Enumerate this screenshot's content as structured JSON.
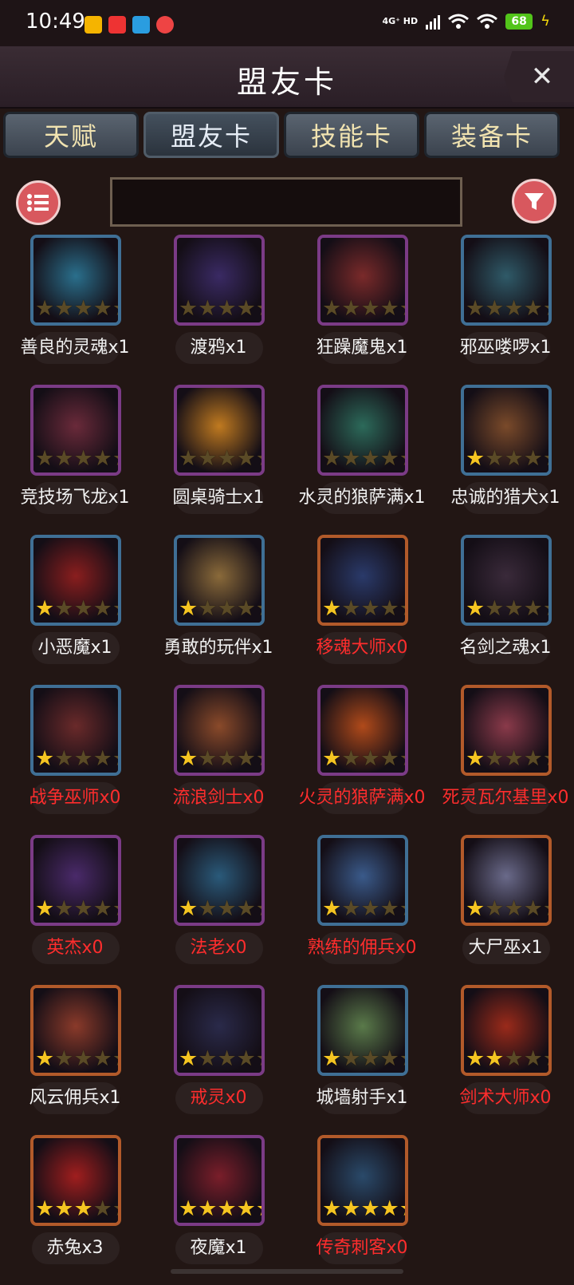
{
  "status": {
    "time": "10:49",
    "network": "4G⁺ HD",
    "battery": "68"
  },
  "header": {
    "title": "盟友卡",
    "close_icon": "close-icon"
  },
  "tabs": [
    {
      "label": "天赋",
      "active": false
    },
    {
      "label": "盟友卡",
      "active": true
    },
    {
      "label": "技能卡",
      "active": false
    },
    {
      "label": "装备卡",
      "active": false
    }
  ],
  "toolbar": {
    "list_icon": "list-icon",
    "filter_icon": "filter-icon",
    "search_value": ""
  },
  "colors": {
    "owned": "#f2f2f2",
    "missing": "#ff2d2d",
    "star_on": "#f5c521",
    "star_off": "#5a4a26"
  },
  "cards": [
    {
      "name": "善良的灵魂x1",
      "stars": 0,
      "owned": true,
      "border": "blue",
      "art": "#2a6f8c"
    },
    {
      "name": "渡鸦x1",
      "stars": 0,
      "owned": true,
      "border": "purple",
      "art": "#3a2a64"
    },
    {
      "name": "狂躁魔鬼x1",
      "stars": 0,
      "owned": true,
      "border": "purple",
      "art": "#7a2a2a"
    },
    {
      "name": "邪巫喽啰x1",
      "stars": 0,
      "owned": true,
      "border": "blue",
      "art": "#2f5a68"
    },
    {
      "name": "竞技场飞龙x1",
      "stars": 0,
      "owned": true,
      "border": "purple",
      "art": "#6a2a3a"
    },
    {
      "name": "圆桌骑士x1",
      "stars": 0,
      "owned": true,
      "border": "purple",
      "art": "#c07a20"
    },
    {
      "name": "水灵的狼萨满x1",
      "stars": 0,
      "owned": true,
      "border": "purple",
      "art": "#2c6a5a"
    },
    {
      "name": "忠诚的猎犬x1",
      "stars": 1,
      "owned": true,
      "border": "blue",
      "art": "#7a4a2a"
    },
    {
      "name": "小恶魔x1",
      "stars": 1,
      "owned": true,
      "border": "blue",
      "art": "#8a1e1e"
    },
    {
      "name": "勇敢的玩伴x1",
      "stars": 1,
      "owned": true,
      "border": "blue",
      "art": "#8a6a3a"
    },
    {
      "name": "移魂大师x0",
      "stars": 1,
      "owned": false,
      "border": "orange",
      "art": "#2a3a6a"
    },
    {
      "name": "名剑之魂x1",
      "stars": 1,
      "owned": true,
      "border": "blue",
      "art": "#3a2a3a"
    },
    {
      "name": "战争巫师x0",
      "stars": 1,
      "owned": false,
      "border": "blue",
      "art": "#6a2a2a"
    },
    {
      "name": "流浪剑士x0",
      "stars": 1,
      "owned": false,
      "border": "purple",
      "art": "#8a4a2a"
    },
    {
      "name": "火灵的狼萨满x0",
      "stars": 1,
      "owned": false,
      "border": "purple",
      "art": "#b04a1a"
    },
    {
      "name": "死灵瓦尔基里x0",
      "stars": 1,
      "owned": false,
      "border": "orange",
      "art": "#8a3a4a"
    },
    {
      "name": "英杰x0",
      "stars": 1,
      "owned": false,
      "border": "purple",
      "art": "#4a2a6a"
    },
    {
      "name": "法老x0",
      "stars": 1,
      "owned": false,
      "border": "purple",
      "art": "#2a5a7a"
    },
    {
      "name": "熟练的佣兵x0",
      "stars": 1,
      "owned": false,
      "border": "blue",
      "art": "#3a5a8a"
    },
    {
      "name": "大尸巫x1",
      "stars": 1,
      "owned": true,
      "border": "orange",
      "art": "#6a6a8a"
    },
    {
      "name": "风云佣兵x1",
      "stars": 1,
      "owned": true,
      "border": "orange",
      "art": "#8a3a2a"
    },
    {
      "name": "戒灵x0",
      "stars": 1,
      "owned": false,
      "border": "purple",
      "art": "#2a2a4a"
    },
    {
      "name": "城墙射手x1",
      "stars": 1,
      "owned": true,
      "border": "blue",
      "art": "#5a7a4a"
    },
    {
      "name": "剑术大师x0",
      "stars": 2,
      "owned": false,
      "border": "orange",
      "art": "#9a2a1a"
    },
    {
      "name": "赤兔x3",
      "stars": 3,
      "owned": true,
      "border": "orange",
      "art": "#a01e1e"
    },
    {
      "name": "夜魔x1",
      "stars": 5,
      "owned": true,
      "border": "purple",
      "art": "#7a1e2a"
    },
    {
      "name": "传奇刺客x0",
      "stars": 5,
      "owned": false,
      "border": "orange",
      "art": "#2a4a6a"
    }
  ]
}
